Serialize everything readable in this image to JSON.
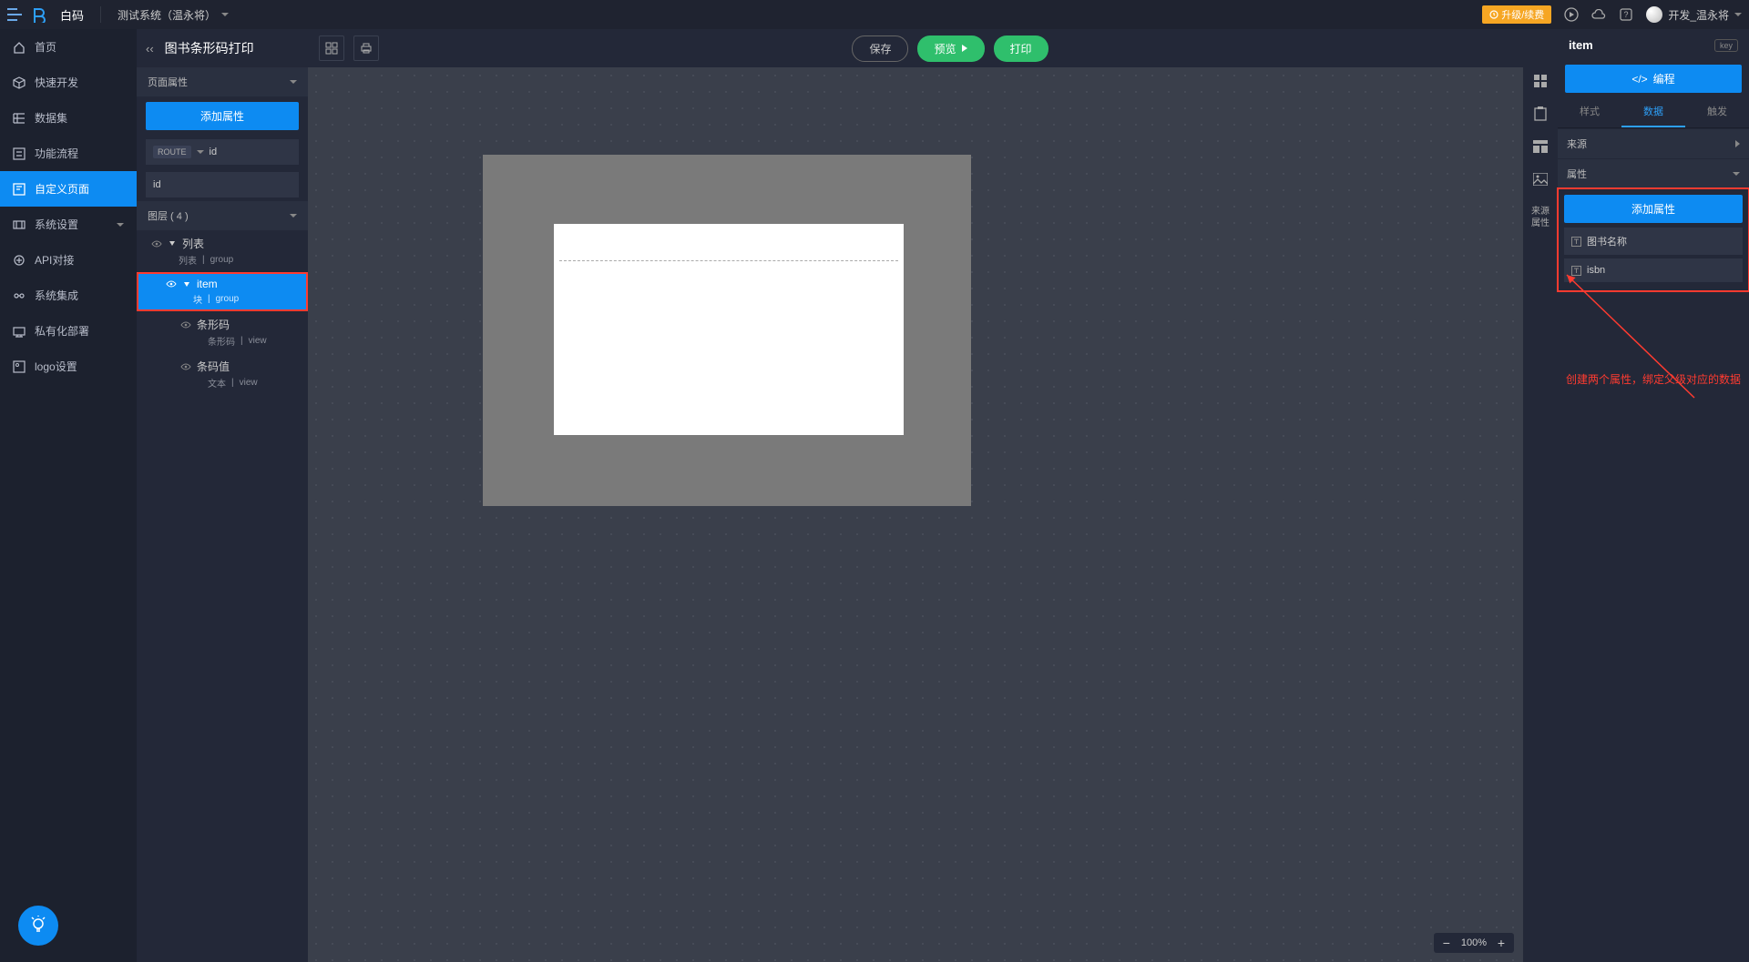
{
  "topbar": {
    "brand": "白码",
    "system_selector": "测试系统（温永将）",
    "upgrade": "升级/续费",
    "user": "开发_温永将"
  },
  "leftnav": {
    "items": [
      {
        "label": "首页"
      },
      {
        "label": "快速开发"
      },
      {
        "label": "数据集"
      },
      {
        "label": "功能流程"
      },
      {
        "label": "自定义页面",
        "active": true
      },
      {
        "label": "系统设置",
        "expandable": true
      },
      {
        "label": "API对接"
      },
      {
        "label": "系统集成"
      },
      {
        "label": "私有化部署"
      },
      {
        "label": "logo设置"
      }
    ]
  },
  "panel2": {
    "title": "图书条形码打印",
    "sect_page_props": "页面属性",
    "add_prop": "添加属性",
    "route_label": "ROUTE",
    "route_value": "id",
    "id_value": "id",
    "sect_layers": "图层 ( 4 )",
    "layers": [
      {
        "name": "列表",
        "type1": "列表",
        "type2": "group"
      },
      {
        "name": "item",
        "type1": "块",
        "type2": "group",
        "selected": true,
        "highlighted": true
      },
      {
        "name": "条形码",
        "type1": "条形码",
        "type2": "view"
      },
      {
        "name": "条码值",
        "type1": "文本",
        "type2": "view"
      }
    ]
  },
  "center": {
    "save": "保存",
    "preview": "预览",
    "print": "打印",
    "zoom": "100%"
  },
  "rail": {
    "source_attr": "来源属性"
  },
  "inspector": {
    "title": "item",
    "key": "key",
    "edit": "编程",
    "tabs": {
      "style": "样式",
      "data": "数据",
      "trigger": "触发"
    },
    "sect_source": "来源",
    "sect_attr": "属性",
    "add_prop": "添加属性",
    "props": [
      {
        "label": "图书名称"
      },
      {
        "label": "isbn"
      }
    ],
    "annotation": "创建两个属性，绑定父级对应的数据"
  }
}
